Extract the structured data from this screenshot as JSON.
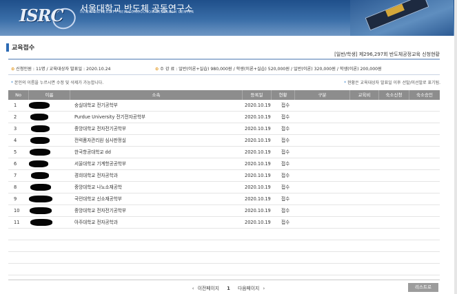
{
  "header": {
    "logo_text": "ISRC",
    "brand_ko": "서울대학교 반도체 공동연구소",
    "brand_en": "INTER-UNIVERSITY SEMICONDUCTOR RESEARCH CENTER"
  },
  "page": {
    "title": "교육접수",
    "subtitle": "[일반/학생] 제296,297회 반도체공정교육 신청현황",
    "info_left": "신청인원 : 11명 / 교육대상자 발표일 : 2020.10.24",
    "info_right": "수 강 료 : 일반(이론+실습) 980,000원 / 학생(이론+실습) 520,000원 / 일반(이론) 320,000원 / 학생(이론) 200,000원",
    "note_left": "본인의 이름을 누르시면 수정 및 삭제가 가능합니다.",
    "note_right": "현황은 교육대상자 발표일 이후 선발/미선발로 표기됨."
  },
  "table": {
    "columns": [
      "No",
      "이름",
      "소속",
      "등록일",
      "현황",
      "구분",
      "교육비",
      "숙소신청",
      "숙소승인"
    ],
    "rows": [
      {
        "no": "1",
        "org": "숭실대학교 전기공학부",
        "date": "2020.10.19",
        "status": "접수"
      },
      {
        "no": "2",
        "org": "Purdue University 전기전자공학부",
        "date": "2020.10.19",
        "status": "접수"
      },
      {
        "no": "3",
        "org": "중앙대학교 전자전기공학부",
        "date": "2020.10.19",
        "status": "접수"
      },
      {
        "no": "4",
        "org": "전력품자관리원 심사판정실",
        "date": "2020.10.19",
        "status": "접수"
      },
      {
        "no": "5",
        "org": "한국항공대학교 dd",
        "date": "2020.10.19",
        "status": "접수"
      },
      {
        "no": "6",
        "org": "서울대학교 기계항공공학부",
        "date": "2020.10.19",
        "status": "접수"
      },
      {
        "no": "7",
        "org": "경희대학교 전자공학과",
        "date": "2020.10.19",
        "status": "접수"
      },
      {
        "no": "8",
        "org": "중앙대학교 나노소재공학",
        "date": "2020.10.19",
        "status": "접수"
      },
      {
        "no": "9",
        "org": "국민대학교 신소재공학부",
        "date": "2020.10.19",
        "status": "접수"
      },
      {
        "no": "10",
        "org": "중앙대학교 전자전기공학부",
        "date": "2020.10.19",
        "status": "접수"
      },
      {
        "no": "11",
        "org": "아주대학교 전자공학과",
        "date": "2020.10.19",
        "status": "접수"
      }
    ]
  },
  "pager": {
    "prev": "이전페이지",
    "current": "1",
    "next": "다음페이지"
  },
  "list_button": "리스트로",
  "colors": {
    "header_blue": "#2a5d9a",
    "table_header": "#8d8d8d",
    "accent_orange": "#e08a00"
  }
}
